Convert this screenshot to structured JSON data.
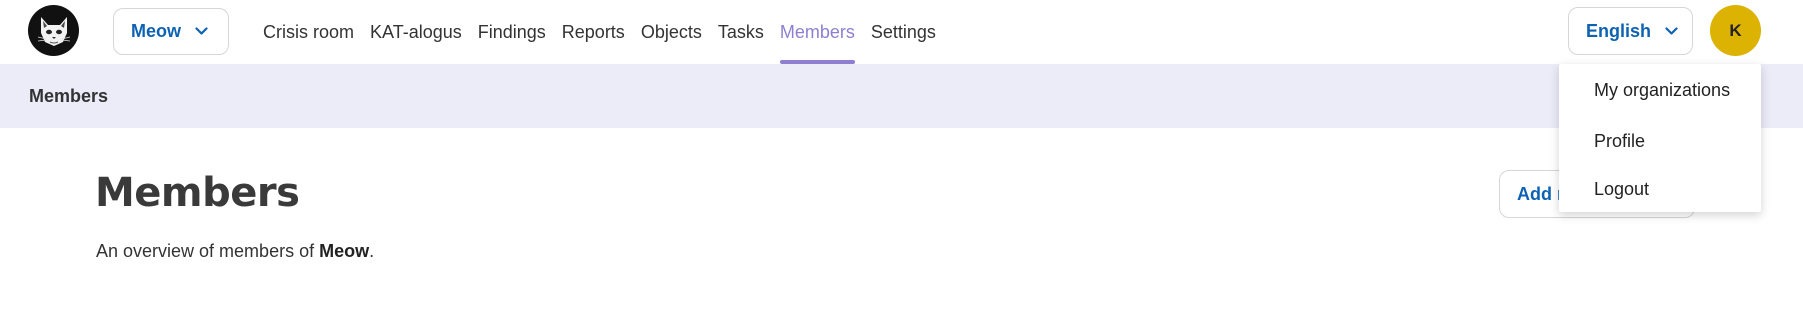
{
  "header": {
    "organization": {
      "label": "Meow"
    },
    "nav": [
      {
        "label": "Crisis room",
        "active": false
      },
      {
        "label": "KAT-alogus",
        "active": false
      },
      {
        "label": "Findings",
        "active": false
      },
      {
        "label": "Reports",
        "active": false
      },
      {
        "label": "Objects",
        "active": false
      },
      {
        "label": "Tasks",
        "active": false
      },
      {
        "label": "Members",
        "active": true
      },
      {
        "label": "Settings",
        "active": false
      }
    ],
    "language": {
      "label": "English"
    },
    "user": {
      "initial": "K"
    }
  },
  "breadcrumb": {
    "current": "Members"
  },
  "main": {
    "title": "Members",
    "intro_prefix": "An overview of members of ",
    "intro_org": "Meow",
    "intro_suffix": ".",
    "add_button": "Add member"
  },
  "user_menu": {
    "items": [
      "My organizations",
      "Profile",
      "Logout"
    ]
  },
  "colors": {
    "accent": "#8f7fd1",
    "link": "#0e62b3",
    "breadcrumb_bg": "#ecebf8",
    "avatar_bg": "#dcb203"
  }
}
